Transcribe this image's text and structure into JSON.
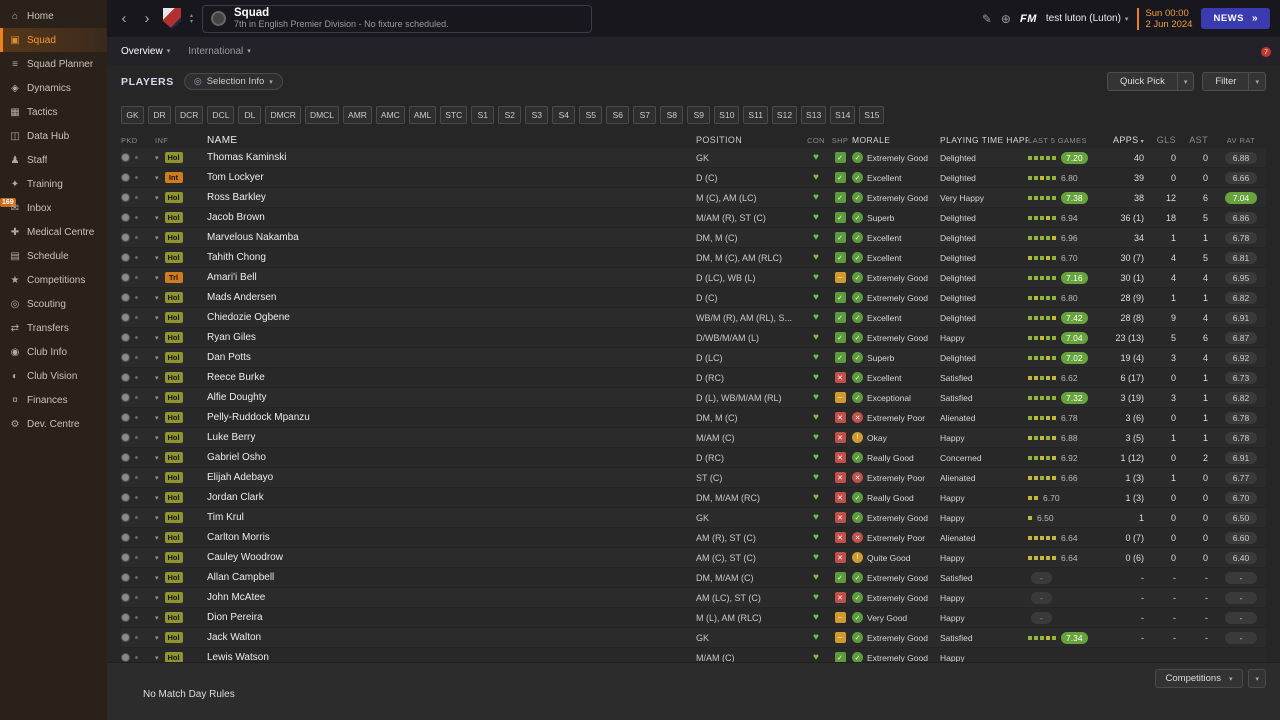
{
  "colors": {
    "accent_orange": "#f08018",
    "green_badge": "#67a33c",
    "red": "#c0504a",
    "amber": "#cf9a2e",
    "news_blue": "#3b3bb0",
    "date_orange": "#f0a040"
  },
  "sidebar": {
    "items": [
      {
        "label": "Home",
        "icon": "home"
      },
      {
        "label": "Squad",
        "icon": "squad",
        "active": true
      },
      {
        "label": "Squad Planner",
        "icon": "squad-planner"
      },
      {
        "label": "Dynamics",
        "icon": "dynamics"
      },
      {
        "label": "Tactics",
        "icon": "tactics"
      },
      {
        "label": "Data Hub",
        "icon": "data-hub"
      },
      {
        "label": "Staff",
        "icon": "staff"
      },
      {
        "label": "Training",
        "icon": "training"
      },
      {
        "label": "Inbox",
        "icon": "inbox",
        "badge": "169"
      },
      {
        "label": "Medical Centre",
        "icon": "medical"
      },
      {
        "label": "Schedule",
        "icon": "schedule"
      },
      {
        "label": "Competitions",
        "icon": "competitions"
      },
      {
        "label": "Scouting",
        "icon": "scouting"
      },
      {
        "label": "Transfers",
        "icon": "transfers"
      },
      {
        "label": "Club Info",
        "icon": "club-info"
      },
      {
        "label": "Club Vision",
        "icon": "club-vision"
      },
      {
        "label": "Finances",
        "icon": "finances"
      },
      {
        "label": "Dev. Centre",
        "icon": "dev-centre"
      }
    ]
  },
  "header": {
    "title": "Squad",
    "subtitle": "7th in English Premier Division - No fixture scheduled.",
    "manager_team": "test luton (Luton)",
    "fm_label": "FM",
    "date_line1": "Sun 00:00",
    "date_line2": "2 Jun 2024",
    "news_label": "NEWS",
    "notification_count": "7"
  },
  "tabs": {
    "overview": "Overview",
    "international": "International"
  },
  "toolbar": {
    "players_label": "PLAYERS",
    "selection_info_label": "Selection Info",
    "quick_pick_label": "Quick Pick",
    "filter_label": "Filter"
  },
  "position_filters": [
    "GK",
    "DR",
    "DCR",
    "DCL",
    "DL",
    "DMCR",
    "DMCL",
    "AMR",
    "AMC",
    "AML",
    "STC",
    "S1",
    "S2",
    "S3",
    "S4",
    "S5",
    "S6",
    "S7",
    "S8",
    "S9",
    "S10",
    "S11",
    "S12",
    "S13",
    "S14",
    "S15"
  ],
  "table": {
    "columns": [
      {
        "label": "PKD"
      },
      {
        "label": "INF"
      },
      {
        "label": "NAME"
      },
      {
        "label": "POSITION"
      },
      {
        "label": "CON"
      },
      {
        "label": "SHP"
      },
      {
        "label": "MORALE"
      },
      {
        "label": "PLAYING TIME HAPPINESS"
      },
      {
        "label": "LAST 5 GAMES"
      },
      {
        "label": "APPS",
        "sort": true
      },
      {
        "label": "GLS"
      },
      {
        "label": "AST"
      },
      {
        "label": "AV RAT"
      }
    ],
    "rows": [
      {
        "inf": "Hol",
        "inf_type": "hol",
        "name": "Thomas Kaminski",
        "position": "GK",
        "shp": "green",
        "morale": "Extremely Good",
        "morale_color": "green",
        "happiness": "Delighted",
        "last5": [
          "g",
          "g",
          "g",
          "g",
          "g"
        ],
        "last5_rating": "7.20",
        "last5_badge": true,
        "apps": "40",
        "gls": "0",
        "ast": "0",
        "avrat": "6.88",
        "avrat_badge": false
      },
      {
        "inf": "Int",
        "inf_type": "int",
        "name": "Tom Lockyer",
        "position": "D (C)",
        "shp": "green",
        "morale": "Excellent",
        "morale_color": "green",
        "happiness": "Delighted",
        "last5": [
          "g",
          "g",
          "y",
          "g",
          "g"
        ],
        "last5_rating": "6.80",
        "last5_badge": false,
        "apps": "39",
        "gls": "0",
        "ast": "0",
        "avrat": "6.66",
        "avrat_badge": false
      },
      {
        "inf": "Hol",
        "inf_type": "hol",
        "name": "Ross Barkley",
        "position": "M (C), AM (LC)",
        "shp": "green",
        "morale": "Extremely Good",
        "morale_color": "green",
        "happiness": "Very Happy",
        "last5": [
          "g",
          "g",
          "g",
          "g",
          "g"
        ],
        "last5_rating": "7.38",
        "last5_badge": true,
        "apps": "38",
        "gls": "12",
        "ast": "6",
        "avrat": "7.04",
        "avrat_badge": true
      },
      {
        "inf": "Hol",
        "inf_type": "hol",
        "name": "Jacob Brown",
        "position": "M/AM (R), ST (C)",
        "shp": "green",
        "morale": "Superb",
        "morale_color": "green",
        "happiness": "Delighted",
        "last5": [
          "g",
          "g",
          "g",
          "y",
          "g"
        ],
        "last5_rating": "6.94",
        "last5_badge": false,
        "apps": "36 (1)",
        "gls": "18",
        "ast": "5",
        "avrat": "6.86",
        "avrat_badge": false
      },
      {
        "inf": "Hol",
        "inf_type": "hol",
        "name": "Marvelous Nakamba",
        "position": "DM, M (C)",
        "shp": "green",
        "morale": "Excellent",
        "morale_color": "green",
        "happiness": "Delighted",
        "last5": [
          "g",
          "g",
          "g",
          "g",
          "y"
        ],
        "last5_rating": "6.96",
        "last5_badge": false,
        "apps": "34",
        "gls": "1",
        "ast": "1",
        "avrat": "6.78",
        "avrat_badge": false
      },
      {
        "inf": "Hol",
        "inf_type": "hol",
        "name": "Tahith Chong",
        "position": "DM, M (C), AM (RLC)",
        "shp": "green",
        "morale": "Excellent",
        "morale_color": "green",
        "happiness": "Delighted",
        "last5": [
          "y",
          "g",
          "g",
          "y",
          "g"
        ],
        "last5_rating": "6.70",
        "last5_badge": false,
        "apps": "30 (7)",
        "gls": "4",
        "ast": "5",
        "avrat": "6.81",
        "avrat_badge": false
      },
      {
        "inf": "Trl",
        "inf_type": "trl",
        "name": "Amari'i Bell",
        "position": "D (LC), WB (L)",
        "shp": "amber",
        "morale": "Extremely Good",
        "morale_color": "green",
        "happiness": "Delighted",
        "last5": [
          "g",
          "g",
          "g",
          "g",
          "g"
        ],
        "last5_rating": "7.16",
        "last5_badge": true,
        "apps": "30 (1)",
        "gls": "4",
        "ast": "4",
        "avrat": "6.95",
        "avrat_badge": false
      },
      {
        "inf": "Hol",
        "inf_type": "hol",
        "name": "Mads Andersen",
        "position": "D (C)",
        "shp": "green",
        "morale": "Extremely Good",
        "morale_color": "green",
        "happiness": "Delighted",
        "last5": [
          "g",
          "y",
          "g",
          "g",
          "g"
        ],
        "last5_rating": "6.80",
        "last5_badge": false,
        "apps": "28 (9)",
        "gls": "1",
        "ast": "1",
        "avrat": "6.82",
        "avrat_badge": false
      },
      {
        "inf": "Hol",
        "inf_type": "hol",
        "name": "Chiedozie Ogbene",
        "position": "WB/M (R), AM (RL), S...",
        "shp": "green",
        "morale": "Excellent",
        "morale_color": "green",
        "happiness": "Delighted",
        "last5": [
          "g",
          "g",
          "g",
          "g",
          "y"
        ],
        "last5_rating": "7.42",
        "last5_badge": true,
        "apps": "28 (8)",
        "gls": "9",
        "ast": "4",
        "avrat": "6.91",
        "avrat_badge": false
      },
      {
        "inf": "Hol",
        "inf_type": "hol",
        "name": "Ryan Giles",
        "position": "D/WB/M/AM (L)",
        "shp": "green",
        "morale": "Extremely Good",
        "morale_color": "green",
        "happiness": "Happy",
        "last5": [
          "g",
          "g",
          "y",
          "g",
          "g"
        ],
        "last5_rating": "7.04",
        "last5_badge": true,
        "apps": "23 (13)",
        "gls": "5",
        "ast": "6",
        "avrat": "6.87",
        "avrat_badge": false
      },
      {
        "inf": "Hol",
        "inf_type": "hol",
        "name": "Dan Potts",
        "position": "D (LC)",
        "shp": "green",
        "morale": "Superb",
        "morale_color": "green",
        "happiness": "Delighted",
        "last5": [
          "g",
          "g",
          "g",
          "y",
          "g"
        ],
        "last5_rating": "7.02",
        "last5_badge": true,
        "apps": "19 (4)",
        "gls": "3",
        "ast": "4",
        "avrat": "6.92",
        "avrat_badge": false
      },
      {
        "inf": "Hol",
        "inf_type": "hol",
        "name": "Reece Burke",
        "position": "D (RC)",
        "shp": "red",
        "morale": "Excellent",
        "morale_color": "green",
        "happiness": "Satisfied",
        "last5": [
          "y",
          "y",
          "g",
          "y",
          "y"
        ],
        "last5_rating": "6.62",
        "last5_badge": false,
        "apps": "6 (17)",
        "gls": "0",
        "ast": "1",
        "avrat": "6.73",
        "avrat_badge": false
      },
      {
        "inf": "Hol",
        "inf_type": "hol",
        "name": "Alfie Doughty",
        "position": "D (L), WB/M/AM (RL)",
        "shp": "amber",
        "morale": "Exceptional",
        "morale_color": "green",
        "happiness": "Satisfied",
        "last5": [
          "g",
          "g",
          "g",
          "g",
          "g"
        ],
        "last5_rating": "7.32",
        "last5_badge": true,
        "apps": "3 (19)",
        "gls": "3",
        "ast": "1",
        "avrat": "6.82",
        "avrat_badge": false
      },
      {
        "inf": "Hol",
        "inf_type": "hol",
        "name": "Pelly-Ruddock Mpanzu",
        "position": "DM, M (C)",
        "shp": "red",
        "morale": "Extremely Poor",
        "morale_color": "red",
        "happiness": "Alienated",
        "last5": [
          "g",
          "y",
          "g",
          "y",
          "y"
        ],
        "last5_rating": "6.78",
        "last5_badge": false,
        "apps": "3 (6)",
        "gls": "0",
        "ast": "1",
        "avrat": "6.78",
        "avrat_badge": false
      },
      {
        "inf": "Hol",
        "inf_type": "hol",
        "name": "Luke Berry",
        "position": "M/AM (C)",
        "shp": "red",
        "morale": "Okay",
        "morale_color": "amber",
        "happiness": "Happy",
        "last5": [
          "y",
          "g",
          "y",
          "g",
          "y"
        ],
        "last5_rating": "6.88",
        "last5_badge": false,
        "apps": "3 (5)",
        "gls": "1",
        "ast": "1",
        "avrat": "6.78",
        "avrat_badge": false
      },
      {
        "inf": "Hol",
        "inf_type": "hol",
        "name": "Gabriel Osho",
        "position": "D (RC)",
        "shp": "red",
        "morale": "Really Good",
        "morale_color": "green",
        "happiness": "Concerned",
        "last5": [
          "g",
          "g",
          "y",
          "g",
          "y"
        ],
        "last5_rating": "6.92",
        "last5_badge": false,
        "apps": "1 (12)",
        "gls": "0",
        "ast": "2",
        "avrat": "6.91",
        "avrat_badge": false
      },
      {
        "inf": "Hol",
        "inf_type": "hol",
        "name": "Elijah Adebayo",
        "position": "ST (C)",
        "shp": "red",
        "morale": "Extremely Poor",
        "morale_color": "red",
        "happiness": "Alienated",
        "last5": [
          "y",
          "y",
          "g",
          "y",
          "y"
        ],
        "last5_rating": "6.66",
        "last5_badge": false,
        "apps": "1 (3)",
        "gls": "1",
        "ast": "0",
        "avrat": "6.77",
        "avrat_badge": false
      },
      {
        "inf": "Hol",
        "inf_type": "hol",
        "name": "Jordan Clark",
        "position": "DM, M/AM (RC)",
        "shp": "red",
        "morale": "Really Good",
        "morale_color": "green",
        "happiness": "Happy",
        "last5": [
          "y",
          "y"
        ],
        "last5_rating": "6.70",
        "last5_badge": false,
        "apps": "1 (3)",
        "gls": "0",
        "ast": "0",
        "avrat": "6.70",
        "avrat_badge": false
      },
      {
        "inf": "Hol",
        "inf_type": "hol",
        "name": "Tim Krul",
        "position": "GK",
        "shp": "red",
        "morale": "Extremely Good",
        "morale_color": "green",
        "happiness": "Happy",
        "last5": [
          "y"
        ],
        "last5_rating": "6.50",
        "last5_badge": false,
        "apps": "1",
        "gls": "0",
        "ast": "0",
        "avrat": "6.50",
        "avrat_badge": false
      },
      {
        "inf": "Hol",
        "inf_type": "hol",
        "name": "Carlton Morris",
        "position": "AM (R), ST (C)",
        "shp": "red",
        "morale": "Extremely Poor",
        "morale_color": "red",
        "happiness": "Alienated",
        "last5": [
          "y",
          "y",
          "y",
          "y",
          "y"
        ],
        "last5_rating": "6.64",
        "last5_badge": false,
        "apps": "0 (7)",
        "gls": "0",
        "ast": "0",
        "avrat": "6.60",
        "avrat_badge": false
      },
      {
        "inf": "Hol",
        "inf_type": "hol",
        "name": "Cauley Woodrow",
        "position": "AM (C), ST (C)",
        "shp": "red",
        "morale": "Quite Good",
        "morale_color": "amber",
        "happiness": "Happy",
        "last5": [
          "y",
          "y",
          "y",
          "y",
          "y"
        ],
        "last5_rating": "6.64",
        "last5_badge": false,
        "apps": "0 (6)",
        "gls": "0",
        "ast": "0",
        "avrat": "6.40",
        "avrat_badge": false
      },
      {
        "inf": "Hol",
        "inf_type": "hol",
        "name": "Allan Campbell",
        "position": "DM, M/AM (C)",
        "shp": "green",
        "morale": "Extremely Good",
        "morale_color": "green",
        "happiness": "Satisfied",
        "last5": [],
        "last5_rating": "-",
        "last5_badge": false,
        "apps": "-",
        "gls": "-",
        "ast": "-",
        "avrat": "-",
        "avrat_badge": false
      },
      {
        "inf": "Hol",
        "inf_type": "hol",
        "name": "John McAtee",
        "position": "AM (LC), ST (C)",
        "shp": "red",
        "morale": "Extremely Good",
        "morale_color": "green",
        "happiness": "Happy",
        "last5": [],
        "last5_rating": "-",
        "last5_badge": false,
        "apps": "-",
        "gls": "-",
        "ast": "-",
        "avrat": "-",
        "avrat_badge": false
      },
      {
        "inf": "Hol",
        "inf_type": "hol",
        "name": "Dion Pereira",
        "position": "M (L), AM (RLC)",
        "shp": "amber",
        "morale": "Very Good",
        "morale_color": "green",
        "happiness": "Happy",
        "last5": [],
        "last5_rating": "-",
        "last5_badge": false,
        "apps": "-",
        "gls": "-",
        "ast": "-",
        "avrat": "-",
        "avrat_badge": false
      },
      {
        "inf": "Hol",
        "inf_type": "hol",
        "name": "Jack Walton",
        "position": "GK",
        "shp": "amber",
        "morale": "Extremely Good",
        "morale_color": "green",
        "happiness": "Satisfied",
        "last5": [
          "g",
          "g",
          "g",
          "y",
          "g"
        ],
        "last5_rating": "7.34",
        "last5_badge": true,
        "apps": "-",
        "gls": "-",
        "ast": "-",
        "avrat": "-",
        "avrat_badge": false
      },
      {
        "inf": "Hol",
        "inf_type": "hol",
        "name": "Lewis Watson",
        "position": "M/AM (C)",
        "shp": "green",
        "morale": "Extremely Good",
        "morale_color": "green",
        "happiness": "Happy",
        "last5": [],
        "last5_rating": "",
        "last5_badge": false,
        "apps": "",
        "gls": "",
        "ast": "",
        "avrat": "",
        "avrat_badge": false
      }
    ]
  },
  "footer": {
    "note": "No Match Day Rules",
    "competitions_label": "Competitions"
  }
}
